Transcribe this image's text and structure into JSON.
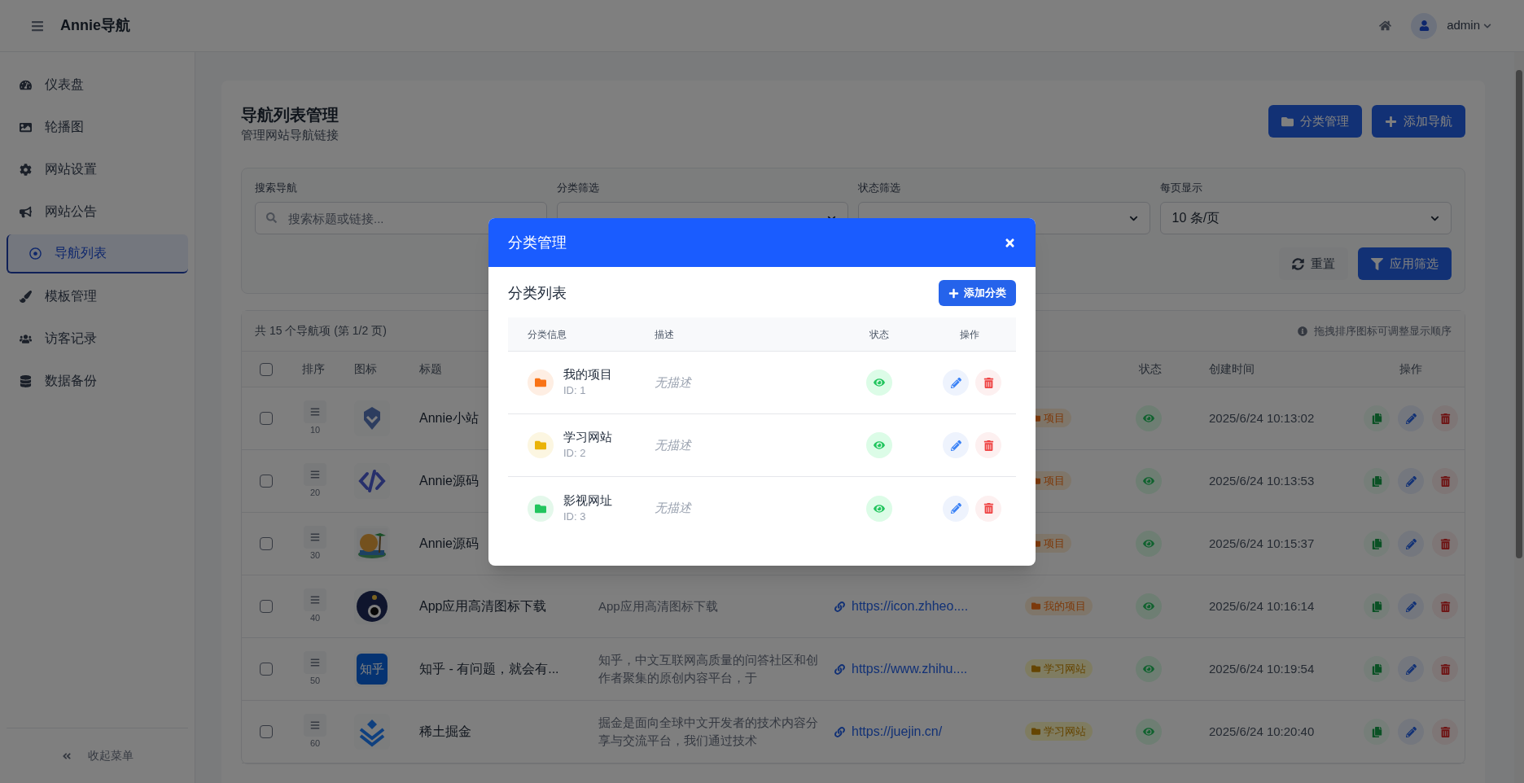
{
  "app": {
    "title": "Annie导航",
    "user": "admin"
  },
  "sidebar": {
    "items": [
      {
        "label": "仪表盘",
        "selected": false
      },
      {
        "label": "轮播图",
        "selected": false
      },
      {
        "label": "网站设置",
        "selected": false
      },
      {
        "label": "网站公告",
        "selected": false
      },
      {
        "label": "导航列表",
        "selected": true
      },
      {
        "label": "模板管理",
        "selected": false
      },
      {
        "label": "访客记录",
        "selected": false
      },
      {
        "label": "数据备份",
        "selected": false
      }
    ],
    "collapse": "收起菜单"
  },
  "page": {
    "title": "导航列表管理",
    "subtitle": "管理网站导航链接",
    "buttons": [
      {
        "label": "分类管理"
      },
      {
        "label": "添加导航"
      }
    ]
  },
  "filters": [
    {
      "label": "搜索导航",
      "kind": "search",
      "placeholder": "搜索标题或链接..."
    },
    {
      "label": "分类筛选",
      "kind": "select"
    },
    {
      "label": "状态筛选",
      "kind": "select"
    },
    {
      "label": "每页显示",
      "kind": "select",
      "value": "10 条/页"
    }
  ],
  "filter_buttons": [
    {
      "label": "重置",
      "kind": "secondary"
    },
    {
      "label": "应用筛选",
      "kind": "primary"
    }
  ],
  "table": {
    "summary": "共 15 个导航项 (第 1/2 页)",
    "hint": "拖拽排序图标可调整显示顺序",
    "select_all": {
      "checked": false
    },
    "columns": [
      "排序",
      "图标",
      "标题",
      "状态",
      "创建时间",
      "操作"
    ],
    "rows": [
      {
        "checked": false,
        "sort": "10",
        "title": "Annie小站",
        "category": {
          "label": "项目",
          "kind": "project"
        },
        "visible": true,
        "created": "2025/6/24 10:13:02"
      },
      {
        "checked": false,
        "sort": "20",
        "title": "Annie源码",
        "category": {
          "label": "项目",
          "kind": "project"
        },
        "visible": true,
        "created": "2025/6/24 10:13:53"
      },
      {
        "checked": false,
        "sort": "30",
        "title": "Annie源码",
        "category": {
          "label": "项目",
          "kind": "project"
        },
        "visible": true,
        "created": "2025/6/24 10:15:37"
      },
      {
        "checked": false,
        "sort": "40",
        "title": "App应用高清图标下载",
        "description": "App应用高清图标下载",
        "link": "https://icon.zhheo....",
        "category": {
          "label": "我的项目",
          "kind": "project"
        },
        "visible": true,
        "created": "2025/6/24 10:16:14"
      },
      {
        "checked": false,
        "sort": "50",
        "icon_text": "知乎",
        "title": "知乎 - 有问题，就会有...",
        "description": "知乎，中文互联网高质量的问答社区和创作者聚集的原创内容平台，于",
        "link": "https://www.zhihu....",
        "category": {
          "label": "学习网站",
          "kind": "learning"
        },
        "visible": true,
        "created": "2025/6/24 10:19:54"
      },
      {
        "checked": false,
        "sort": "60",
        "title": "稀土掘金",
        "description": "掘金是面向全球中文开发者的技术内容分享与交流平台，我们通过技术",
        "link": "https://juejin.cn/",
        "category": {
          "label": "学习网站",
          "kind": "learning"
        },
        "visible": true,
        "created": "2025/6/24 10:20:40"
      }
    ]
  },
  "modal": {
    "title": "分类管理",
    "list_title": "分类列表",
    "add_button": "添加分类",
    "columns": [
      "分类信息",
      "描述",
      "状态",
      "操作"
    ],
    "rows": [
      {
        "name": "我的项目",
        "id": "ID: 1",
        "description": "无描述",
        "color": "#f97316",
        "visible": true
      },
      {
        "name": "学习网站",
        "id": "ID: 2",
        "description": "无描述",
        "color": "#eab308",
        "visible": true
      },
      {
        "name": "影视网址",
        "id": "ID: 3",
        "description": "无描述",
        "color": "#22c55e",
        "visible": true
      }
    ]
  }
}
